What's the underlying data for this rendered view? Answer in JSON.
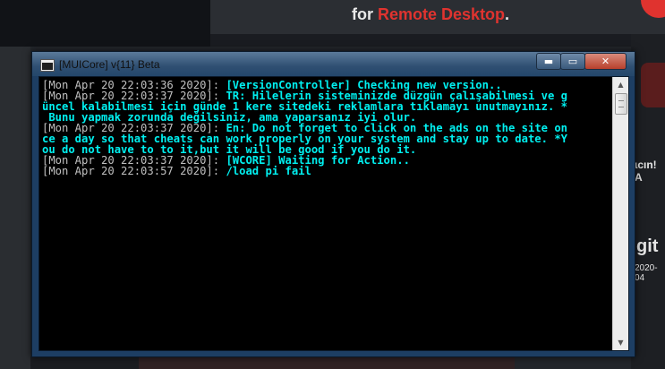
{
  "background": {
    "banner_prefix": "for",
    "banner_accent": "Remote Desktop",
    "banner_suffix": ".",
    "side_text_1": "ɩcın! A",
    "side_text_2": "git",
    "side_text_3": "2020-04",
    "accent_color": "#e0332f"
  },
  "window": {
    "title": "[MUICore] v{11} Beta",
    "controls": {
      "minimize": "▬",
      "maximize": "▭",
      "close": "✕"
    }
  },
  "console": {
    "lines": [
      {
        "ts": "[Mon Apr 20 22:03:36 2020]: ",
        "msg": "[VersionController] Checking new version.."
      },
      {
        "ts": "[Mon Apr 20 22:03:37 2020]: ",
        "msg": "TR: Hilelerin sisteminizde düzgün çalışabilmesi ve g"
      },
      {
        "ts": "",
        "msg": "üncel kalabilmesi için günde 1 kere sitedeki reklamlara tıklamayı unutmayınız. *"
      },
      {
        "ts": "",
        "msg": " Bunu yapmak zorunda değilsiniz, ama yaparsanız iyi olur."
      },
      {
        "ts": "[Mon Apr 20 22:03:37 2020]: ",
        "msg": "En: Do not forget to click on the ads on the site on"
      },
      {
        "ts": "",
        "msg": "ce a day so that cheats can work properly on your system and stay up to date. *Y"
      },
      {
        "ts": "",
        "msg": "ou do not have to to it,but it will be good if you do it."
      },
      {
        "ts": "[Mon Apr 20 22:03:37 2020]: ",
        "msg": "[WCORE] Waiting for Action.."
      },
      {
        "ts": "[Mon Apr 20 22:03:57 2020]: ",
        "msg": "/load pi fail"
      }
    ]
  },
  "colors": {
    "console_bg": "#000000",
    "timestamp": "#c0c0c0",
    "message": "#00f0f0"
  }
}
